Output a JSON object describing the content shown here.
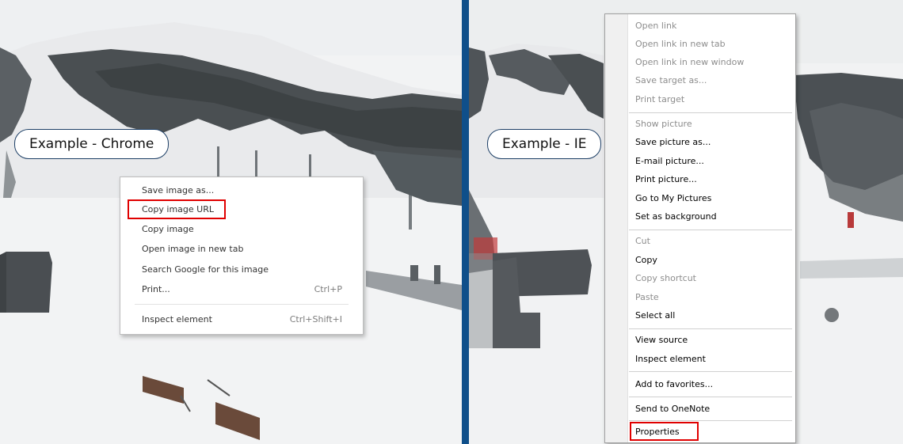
{
  "chrome_example": {
    "label": "Example - Chrome",
    "menu_items": [
      {
        "label": "Save image as...",
        "shortcut": ""
      },
      {
        "label": "Copy image URL",
        "shortcut": ""
      },
      {
        "label": "Copy image",
        "shortcut": ""
      },
      {
        "label": "Open image in new tab",
        "shortcut": ""
      },
      {
        "label": "Search Google for this image",
        "shortcut": ""
      },
      {
        "label": "Print...",
        "shortcut": "Ctrl+P"
      },
      {
        "label": "Inspect element",
        "shortcut": "Ctrl+Shift+I"
      }
    ]
  },
  "ie_example": {
    "label": "Example - IE",
    "menu_items": [
      {
        "label": "Open link",
        "disabled": true
      },
      {
        "label": "Open link in new tab",
        "disabled": true
      },
      {
        "label": "Open link in new window",
        "disabled": true
      },
      {
        "label": "Save target as...",
        "disabled": true
      },
      {
        "label": "Print target",
        "disabled": true
      },
      {
        "label": "Show picture",
        "disabled": true
      },
      {
        "label": "Save picture as...",
        "disabled": false
      },
      {
        "label": "E-mail picture...",
        "disabled": false
      },
      {
        "label": "Print picture...",
        "disabled": false
      },
      {
        "label": "Go to My Pictures",
        "disabled": false
      },
      {
        "label": "Set as background",
        "disabled": false
      },
      {
        "label": "Cut",
        "disabled": true
      },
      {
        "label": "Copy",
        "disabled": false
      },
      {
        "label": "Copy shortcut",
        "disabled": true
      },
      {
        "label": "Paste",
        "disabled": true
      },
      {
        "label": "Select all",
        "disabled": false
      },
      {
        "label": "View source",
        "disabled": false
      },
      {
        "label": "Inspect element",
        "disabled": false
      },
      {
        "label": "Add to favorites...",
        "disabled": false
      },
      {
        "label": "Send to OneNote",
        "disabled": false
      },
      {
        "label": "Properties",
        "disabled": false
      }
    ]
  },
  "colors": {
    "highlight_border": "#e00000",
    "divider": "#0f4f8a"
  }
}
